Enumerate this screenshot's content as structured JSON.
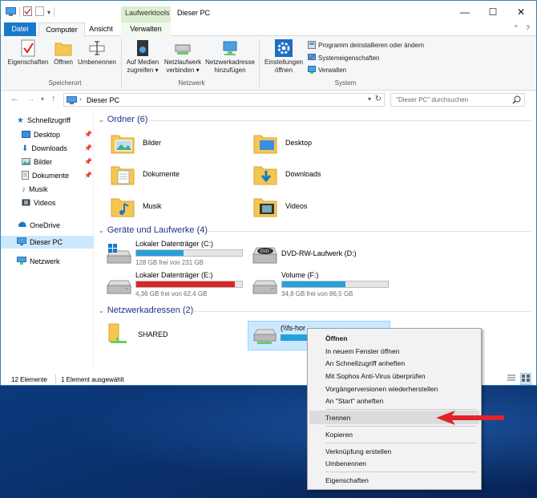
{
  "window": {
    "title": "Dieser PC",
    "context_tab_header": "Laufwerktools",
    "minimize": "—",
    "maximize": "☐",
    "close": "✕"
  },
  "tabs": {
    "file": "Datei",
    "computer": "Computer",
    "ansicht": "Ansicht",
    "verwalten": "Verwalten"
  },
  "ribbon": {
    "eigenschaften": "Eigenschaften",
    "oeffnen": "Öffnen",
    "umbenennen": "Umbenennen",
    "group_speicherort": "Speicherort",
    "medien_1": "Auf Medien",
    "medien_2": "zugreifen ▾",
    "netzlaufwerk_1": "Netzlaufwerk",
    "netzlaufwerk_2": "verbinden ▾",
    "netzadresse_1": "Netzwerkadresse",
    "netzadresse_2": "hinzufügen",
    "group_netzwerk": "Netzwerk",
    "einstellungen_1": "Einstellungen",
    "einstellungen_2": "öffnen",
    "programm": "Programm deinstallieren oder ändern",
    "systemeigenschaften": "Systemeigenschaften",
    "verwalten": "Verwalten",
    "group_system": "System"
  },
  "address": {
    "path": "Dieser PC",
    "search_placeholder": "\"Dieser PC\" durchsuchen"
  },
  "sidebar": {
    "schnellzugriff": "Schnellzugriff",
    "items": [
      "Desktop",
      "Downloads",
      "Bilder",
      "Dokumente",
      "Musik",
      "Videos"
    ],
    "onedrive": "OneDrive",
    "dieser_pc": "Dieser PC",
    "netzwerk": "Netzwerk"
  },
  "sections": {
    "ordner": "Ordner (6)",
    "geraete": "Geräte und Laufwerke (4)",
    "netz": "Netzwerkadressen (2)"
  },
  "folders": [
    "Bilder",
    "Desktop",
    "Dokumente",
    "Downloads",
    "Musik",
    "Videos"
  ],
  "drives": [
    {
      "name": "Lokaler Datenträger (C:)",
      "size": "128 GB frei von 231 GB",
      "used_fraction": 0.45,
      "status_color": "#26a0da"
    },
    {
      "name": "DVD-RW-Laufwerk (D:)",
      "size": "",
      "used_fraction": 0,
      "status_color": ""
    },
    {
      "name": "Lokaler Datenträger (E:)",
      "size": "4,36 GB frei von 62,4 GB",
      "used_fraction": 0.93,
      "status_color": "#da2626"
    },
    {
      "name": "Volume (F:)",
      "size": "34,8 GB frei von 86,5 GB",
      "used_fraction": 0.6,
      "status_color": "#26a0da"
    }
  ],
  "network": {
    "shared": "SHARED",
    "fs": "(\\\\fs-hor"
  },
  "status": {
    "count": "12 Elemente",
    "selected": "1 Element ausgewählt"
  },
  "context_menu": {
    "oeffnen": "Öffnen",
    "neues_fenster": "In neuem Fenster öffnen",
    "schnellzugriff": "An Schnellzugriff anheften",
    "sophos": "Mit Sophos Anti-Virus überprüfen",
    "vorgaenger": "Vorgängerversionen wiederherstellen",
    "start": "An \"Start\" anheften",
    "trennen": "Trennen",
    "kopieren": "Kopieren",
    "verknuepfung": "Verknüpfung erstellen",
    "umbenennen": "Umbenennen",
    "eigenschaften": "Eigenschaften"
  },
  "colors": {
    "accent": "#1979ca",
    "selection": "#cce8ff",
    "arrow": "#e0242a"
  }
}
